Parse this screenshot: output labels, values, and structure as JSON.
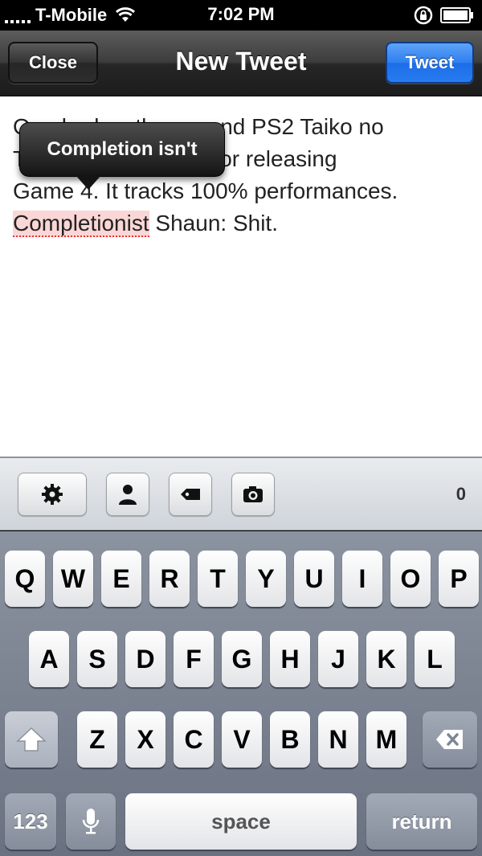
{
  "status_bar": {
    "carrier": "T-Mobile",
    "time": "7:02 PM",
    "signal_bars": 5
  },
  "nav": {
    "close_label": "Close",
    "title": "New Tweet",
    "tweet_label": "Tweet"
  },
  "compose": {
    "line1": "One bad ••• the second PS2 Taiko no",
    "line2": "T••••••••••• a reward for releasing",
    "line3": "Game 4. It tracks 100% performances.",
    "misspelled_word": "Completionist",
    "line4_rest": " Shaun: Shit.",
    "suggestion": "Completion isn't"
  },
  "toolbar": {
    "icons": [
      "gear-icon",
      "person-icon",
      "tag-icon",
      "camera-icon"
    ],
    "char_count": "0"
  },
  "keyboard": {
    "row1": [
      "Q",
      "W",
      "E",
      "R",
      "T",
      "Y",
      "U",
      "I",
      "O",
      "P"
    ],
    "row2": [
      "A",
      "S",
      "D",
      "F",
      "G",
      "H",
      "J",
      "K",
      "L"
    ],
    "row3": [
      "Z",
      "X",
      "C",
      "V",
      "B",
      "N",
      "M"
    ],
    "numbers_label": "123",
    "space_label": "space",
    "return_label": "return"
  },
  "colors": {
    "tweet_button": "#2f7ff0",
    "misspell_highlight": "#fbd6d6",
    "keyboard_bg": "#7a8290"
  }
}
